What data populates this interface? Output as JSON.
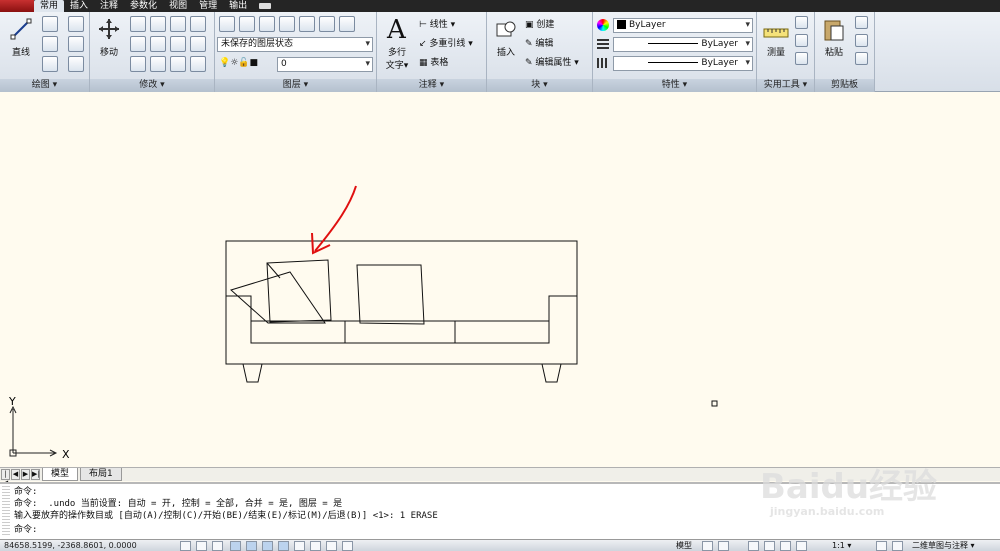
{
  "ribbon_tabs": [
    "常用",
    "插入",
    "注释",
    "参数化",
    "视图",
    "管理",
    "输出"
  ],
  "panels": {
    "draw": {
      "title": "绘图 ▾",
      "line_label": "直线"
    },
    "modify": {
      "title": "修改 ▾",
      "move_label": "移动"
    },
    "layers": {
      "title": "图层 ▾",
      "layer_state": "未保存的图层状态",
      "current_layer": "0"
    },
    "annotation": {
      "title": "注释 ▾",
      "text_label_1": "多行",
      "text_label_2": "文字▾",
      "linear": "线性 ▾",
      "multileader": "多重引线 ▾",
      "table": "表格"
    },
    "block": {
      "title": "块 ▾",
      "insert": "插入",
      "create": "创建",
      "edit": "编辑",
      "edit_attr": "编辑属性 ▾"
    },
    "properties": {
      "title": "特性 ▾",
      "color": "ByLayer",
      "linetype": "ByLayer",
      "lineweight": "ByLayer"
    },
    "utilities": {
      "title": "实用工具 ▾",
      "measure": "测量"
    },
    "clipboard": {
      "title": "剪贴板",
      "paste": "粘贴"
    }
  },
  "canvas": {
    "ucs_y": "Y",
    "ucs_x": "X"
  },
  "layout_tabs": {
    "model": "模型",
    "layout1": "布局1"
  },
  "command_lines": [
    "命令:",
    "命令:  .undo 当前设置: 自动 = 开, 控制 = 全部, 合并 = 是, 图层 = 是",
    "输入要放弃的操作数目或 [自动(A)/控制(C)/开始(BE)/结束(E)/标记(M)/后退(B)] <1>: 1 ERASE",
    "命令:"
  ],
  "status": {
    "coordinates": "84658.5199, -2368.8601, 0.0000",
    "model": "模型",
    "scale": "1:1 ▾",
    "workspace": "二维草图与注释 ▾"
  },
  "watermark": {
    "brand": "Baidu经验",
    "url": "jingyan.baidu.com"
  },
  "colors": {
    "canvas_bg": "#fffbef",
    "arrow": "#e01010",
    "ribbon": "#dfe6ee"
  }
}
